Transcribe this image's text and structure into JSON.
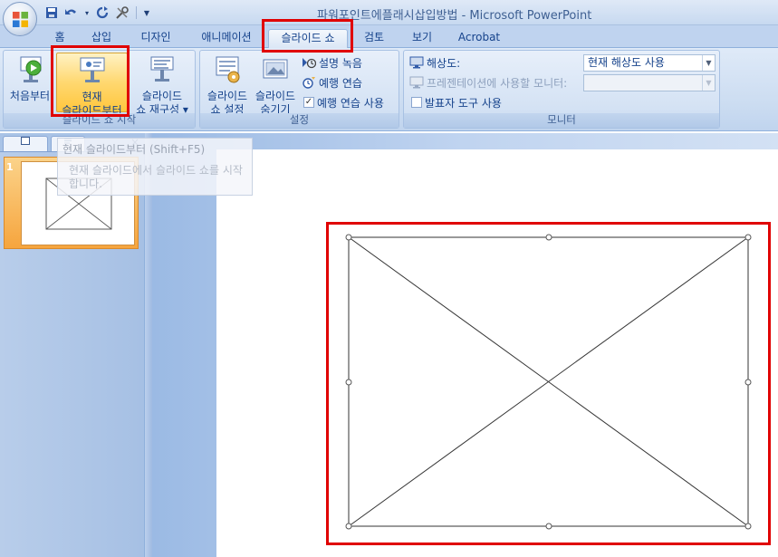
{
  "title": "파워포인트에플래시삽입방법 - Microsoft PowerPoint",
  "qat": {
    "icons": [
      "office-logo",
      "save-icon",
      "undo-icon",
      "redo-icon",
      "tools-icon",
      "customize-icon"
    ],
    "customize_glyph": "▼"
  },
  "tabs": [
    "홈",
    "삽입",
    "디자인",
    "애니메이션",
    "슬라이드 쇼",
    "검토",
    "보기",
    "Acrobat"
  ],
  "active_tab": "슬라이드 쇼",
  "ribbon": {
    "start_group": {
      "label": "슬라이드 쇼 시작",
      "from_beginning": "처음부터",
      "from_current_line1": "현재",
      "from_current_line2": "슬라이드부터",
      "custom_line1": "슬라이드",
      "custom_line2": "쇼 재구성",
      "custom_arrow": "▾"
    },
    "setup_group": {
      "label": "설정",
      "setup_line1": "슬라이드",
      "setup_line2": "쇼 설정",
      "hide_line1": "슬라이드",
      "hide_line2": "숨기기",
      "record_narration": "설명 녹음",
      "rehearse_timings": "예행 연습",
      "use_rehearsed": "예행 연습 사용",
      "use_rehearsed_checked": true
    },
    "monitor_group": {
      "label": "모니터",
      "resolution_label": "해상도:",
      "resolution_value": "현재 해상도 사용",
      "show_on_label": "프레젠테이션에 사용할 모니터:",
      "show_on_value": "",
      "presenter_view": "발표자 도구 사용",
      "presenter_view_checked": false
    }
  },
  "tooltip": {
    "title": "현재 슬라이드부터 (Shift+F5)",
    "body": "현재 슬라이드에서 슬라이드 쇼를 시작합니다."
  },
  "slides_pane": {
    "slide_number": "1",
    "close_glyph": "×"
  },
  "colors": {
    "accent": "#15428b",
    "highlight_box": "#e00000",
    "selected_thumb": "#f6a53e"
  }
}
